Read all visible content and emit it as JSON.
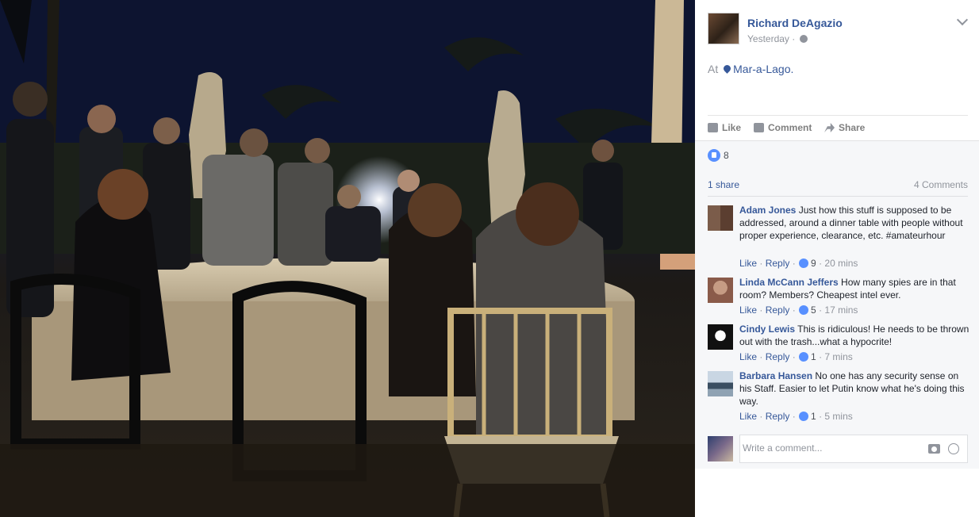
{
  "post": {
    "author": "Richard DeAgazio",
    "timestamp": "Yesterday ·",
    "privacy_icon": "globe-icon",
    "location_prefix": "At",
    "location_name": "Mar-a-Lago."
  },
  "actions": {
    "like_label": "Like",
    "comment_label": "Comment",
    "share_label": "Share"
  },
  "feedback": {
    "reaction_count": "8",
    "share_count": "1 share",
    "comment_count": "4 Comments"
  },
  "comments": [
    {
      "name": "Adam Jones",
      "text": "Just how this stuff is supposed to be addressed, around a dinner table with people without proper experience, clearance, etc. #amateurhour",
      "like_label": "Like",
      "reply_label": "Reply",
      "likes": "9",
      "time": "20 mins"
    },
    {
      "name": "Linda McCann Jeffers",
      "text": "How many spies are in that room? Members? Cheapest intel ever.",
      "like_label": "Like",
      "reply_label": "Reply",
      "likes": "5",
      "time": "17 mins"
    },
    {
      "name": "Cindy Lewis",
      "text": "This is ridiculous! He needs to be thrown out with the trash...what a hypocrite!",
      "like_label": "Like",
      "reply_label": "Reply",
      "likes": "1",
      "time": "7 mins"
    },
    {
      "name": "Barbara Hansen",
      "text": "No one has any security sense on his Staff. Easier to let Putin know what he's doing this way.",
      "like_label": "Like",
      "reply_label": "Reply",
      "likes": "1",
      "time": "5 mins"
    }
  ],
  "composer": {
    "placeholder": "Write a comment..."
  },
  "colors": {
    "link": "#365899",
    "muted": "#90949c",
    "like_blue": "#5890ff",
    "feedback_bg": "#f6f7f9"
  }
}
